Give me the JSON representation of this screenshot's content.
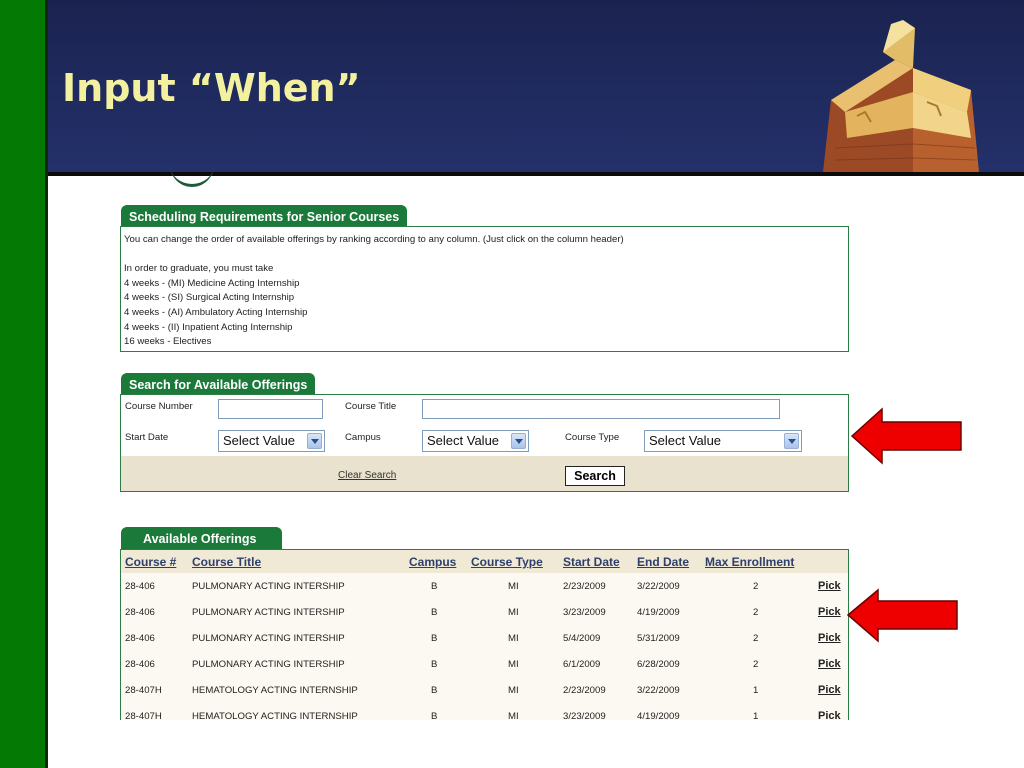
{
  "slide": {
    "title": "Input “When”"
  },
  "requirements": {
    "tab_label": "Scheduling Requirements for Senior Courses",
    "intro": "You can change the order of available offerings by ranking according to any column. (Just click on the column header)",
    "graduate_line": "In order to graduate, you must take",
    "items": [
      "4 weeks - (MI) Medicine Acting Internship",
      "4 weeks - (SI) Surgical Acting Internship",
      "4 weeks - (AI) Ambulatory Acting Internship",
      "4 weeks - (II) Inpatient Acting Internship",
      "16 weeks - Electives"
    ]
  },
  "search": {
    "tab_label": "Search for Available Offerings",
    "course_number_label": "Course Number",
    "course_number_value": "",
    "course_title_label": "Course Title",
    "course_title_value": "",
    "start_date_label": "Start Date",
    "start_date_value": "Select Value",
    "campus_label": "Campus",
    "campus_value": "Select Value",
    "course_type_label": "Course Type",
    "course_type_value": "Select Value",
    "clear_label": "Clear Search",
    "search_label": "Search"
  },
  "offerings": {
    "tab_label": "Available Offerings",
    "columns": [
      "Course #",
      "Course Title",
      "Campus",
      "Course Type",
      "Start Date",
      "End Date",
      "Max Enrollment"
    ],
    "pick_label": "Pick",
    "rows": [
      [
        "28-406",
        "PULMONARY ACTING INTERSHIP",
        "B",
        "MI",
        "2/23/2009",
        "3/22/2009",
        "2"
      ],
      [
        "28-406",
        "PULMONARY ACTING INTERSHIP",
        "B",
        "MI",
        "3/23/2009",
        "4/19/2009",
        "2"
      ],
      [
        "28-406",
        "PULMONARY ACTING INTERSHIP",
        "B",
        "MI",
        "5/4/2009",
        "5/31/2009",
        "2"
      ],
      [
        "28-406",
        "PULMONARY ACTING INTERSHIP",
        "B",
        "MI",
        "6/1/2009",
        "6/28/2009",
        "2"
      ],
      [
        "28-407H",
        "HEMATOLOGY ACTING INTERNSHIP",
        "B",
        "MI",
        "2/23/2009",
        "3/22/2009",
        "1"
      ],
      [
        "28-407H",
        "HEMATOLOGY ACTING INTERNSHIP",
        "B",
        "MI",
        "3/23/2009",
        "4/19/2009",
        "1"
      ]
    ]
  },
  "colors": {
    "slide_green": "#047a04",
    "header_navy": "#1a2350",
    "title_yellow": "#f3f1a0",
    "tab_green": "#1b7a3a",
    "arrow_red": "#ee0000"
  }
}
